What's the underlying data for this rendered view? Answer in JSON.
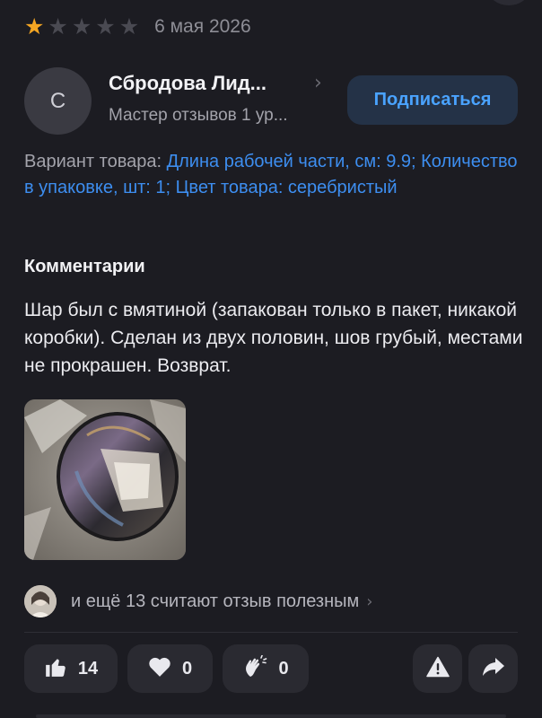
{
  "review": {
    "rating": 1,
    "max_rating": 5,
    "date": "6 мая 2026",
    "author": {
      "initial": "С",
      "name": "Сбродова Лид...",
      "level": "Мастер отзывов 1 ур..."
    },
    "subscribe_label": "Подписаться",
    "variant": {
      "label": "Вариант товара:",
      "value": "Длина рабочей части, см: 9.9; Количество в упаковке, шт: 1; Цвет товара: серебристый"
    },
    "comments_title": "Комментарии",
    "comment": "Шар был с вмятиной (запакован только в пакет, никакой коробки). Сделан из двух половин, шов грубый, местами не прокрашен. Возврат.",
    "helpful_text": "и ещё 13 считают отзыв полезным",
    "actions": {
      "likes": "14",
      "hearts": "0",
      "claps": "0"
    }
  },
  "colors": {
    "background": "#1c1c22",
    "star_active": "#f5a623",
    "star_inactive": "#4a4a52",
    "link": "#3d8ef0",
    "button_bg": "#2a2a31"
  },
  "icons": [
    "star-icon",
    "chevron-right-icon",
    "thumbs-up-icon",
    "heart-icon",
    "clap-icon",
    "warning-icon",
    "share-icon"
  ]
}
